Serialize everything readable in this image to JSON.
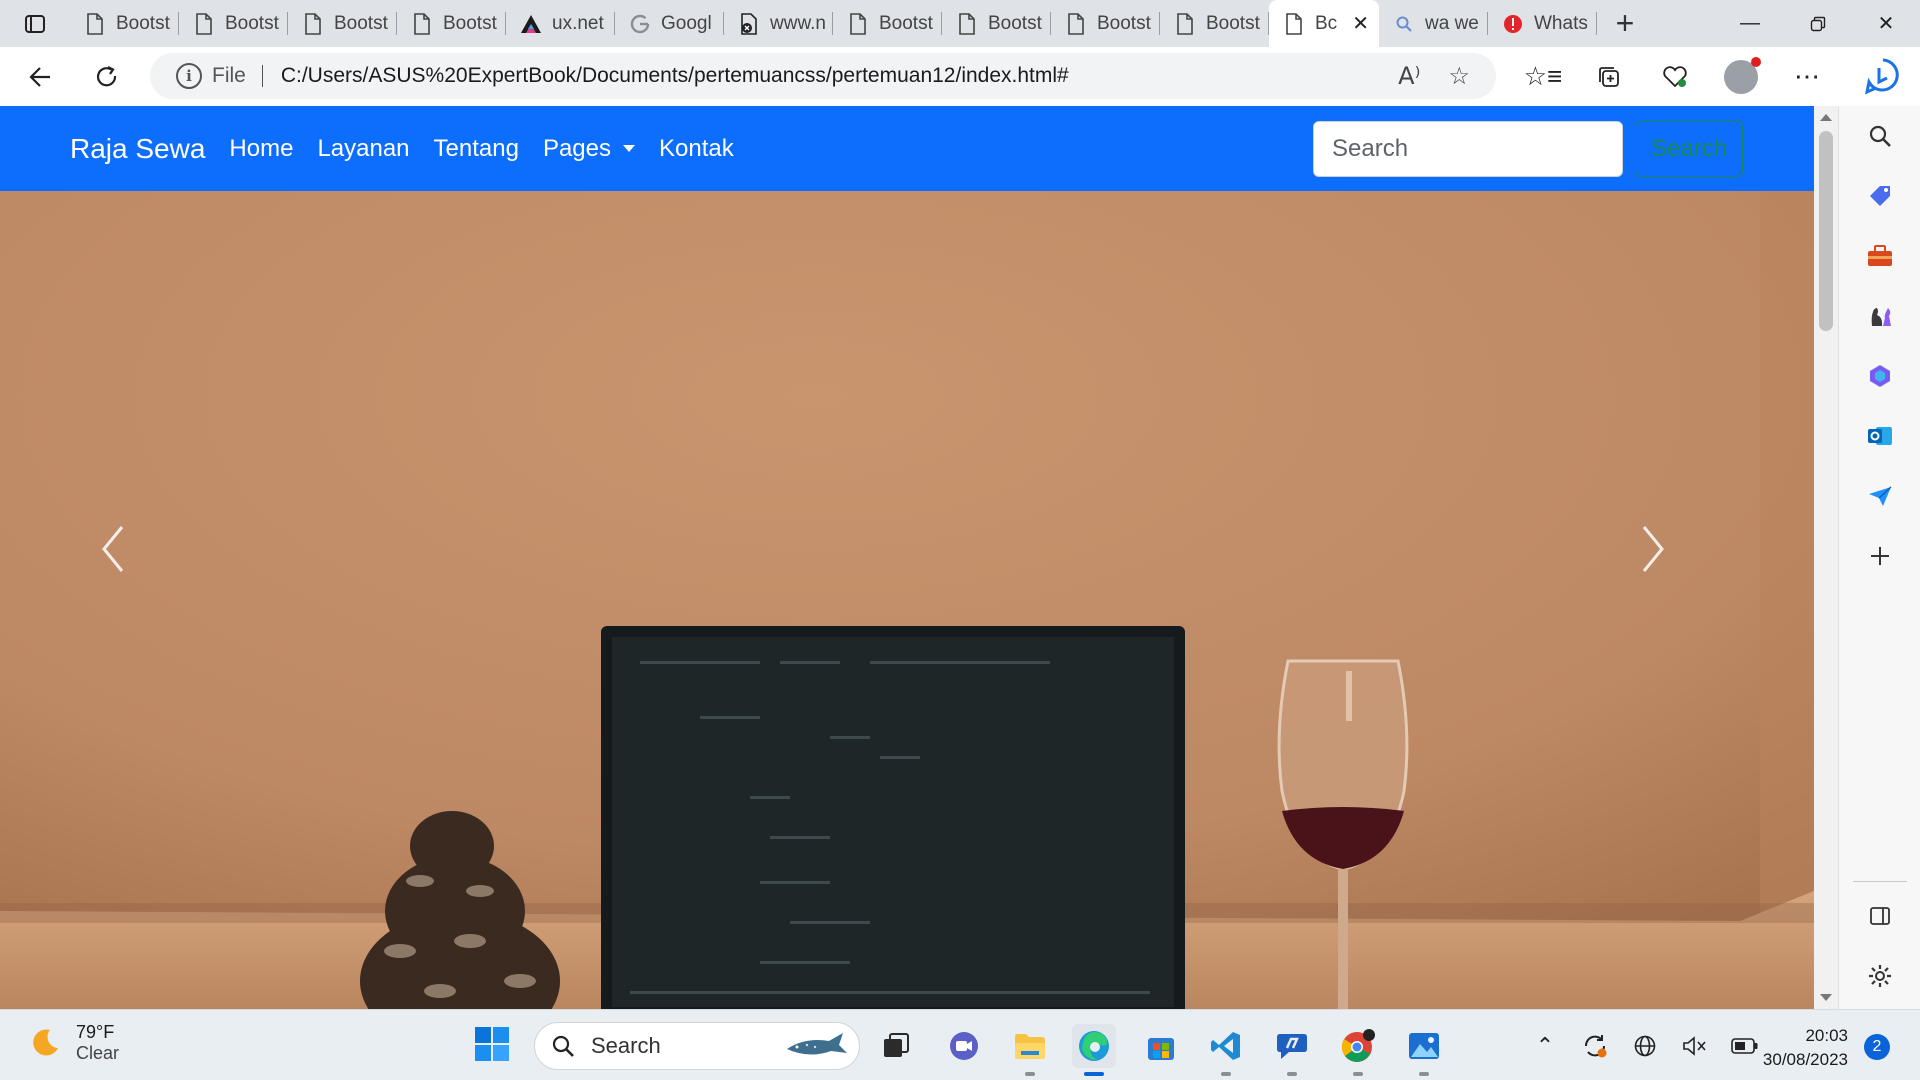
{
  "browser": {
    "tabs": [
      {
        "label": "Bootst",
        "icon": "page-icon"
      },
      {
        "label": "Bootst",
        "icon": "page-icon"
      },
      {
        "label": "Bootst",
        "icon": "page-icon"
      },
      {
        "label": "Bootst",
        "icon": "page-icon"
      },
      {
        "label": "ux.net",
        "icon": "ux-logo-icon"
      },
      {
        "label": "Googl",
        "icon": "google-icon"
      },
      {
        "label": "www.n",
        "icon": "blocked-page-icon"
      },
      {
        "label": "Bootst",
        "icon": "page-icon"
      },
      {
        "label": "Bootst",
        "icon": "page-icon"
      },
      {
        "label": "Bootst",
        "icon": "page-icon"
      },
      {
        "label": "Bootst",
        "icon": "page-icon"
      },
      {
        "label": "Bc",
        "icon": "page-icon",
        "active": true
      },
      {
        "label": "wa we",
        "icon": "search-icon"
      },
      {
        "label": "Whats",
        "icon": "alert-icon"
      }
    ],
    "address": {
      "scheme_label": "File",
      "url": "C:/Users/ASUS%20ExpertBook/Documents/pertemuancss/pertemuan12/index.html#"
    }
  },
  "page": {
    "brand": "Raja Sewa",
    "nav_links": [
      "Home",
      "Layanan",
      "Tentang",
      "Pages",
      "Kontak"
    ],
    "search": {
      "placeholder": "Search",
      "button_label": "Search"
    },
    "colors": {
      "navbar": "#0d6efd",
      "search_button": "#198754"
    }
  },
  "taskbar": {
    "weather": {
      "temp": "79°F",
      "condition": "Clear"
    },
    "search_label": "Search",
    "clock": {
      "time": "20:03",
      "date": "30/08/2023"
    },
    "notification_count": "2"
  }
}
